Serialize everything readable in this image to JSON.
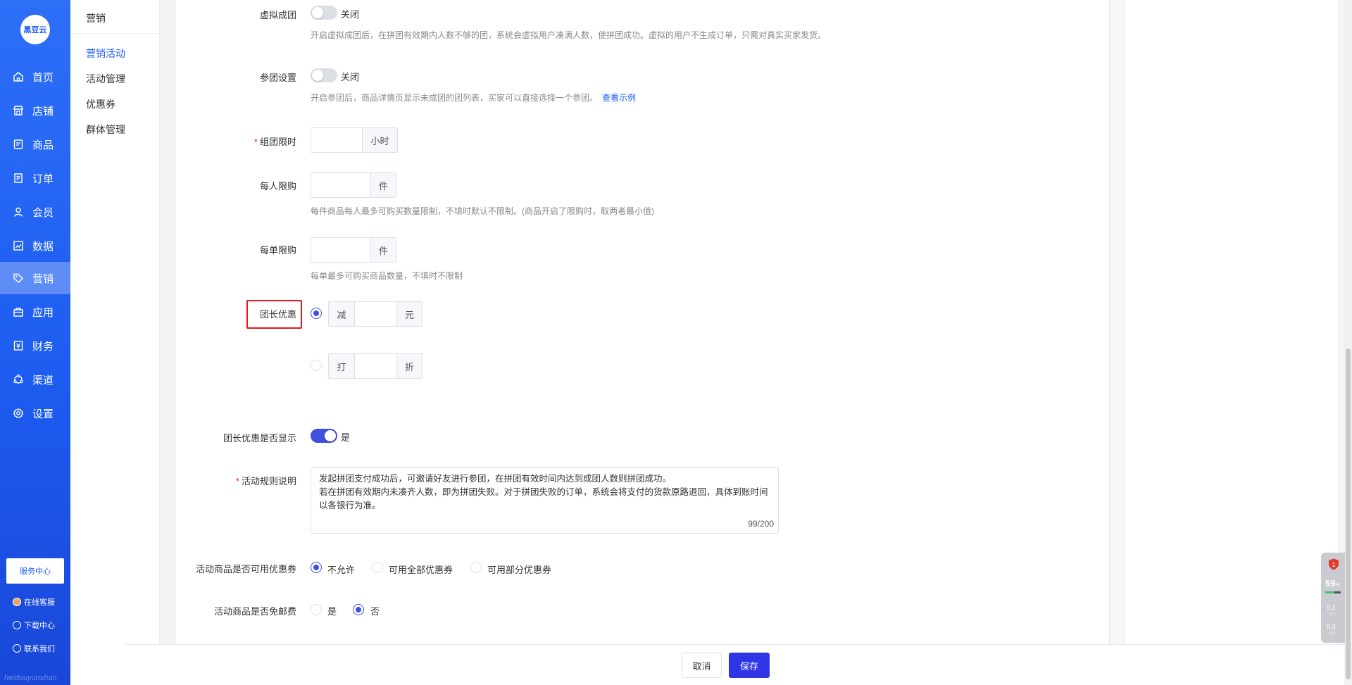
{
  "brand": {
    "logo_text": "黑豆云",
    "watermark": "heidouyunshan"
  },
  "nav": {
    "items": [
      {
        "label": "首页",
        "icon": "home-icon"
      },
      {
        "label": "店铺",
        "icon": "shop-icon"
      },
      {
        "label": "商品",
        "icon": "goods-icon"
      },
      {
        "label": "订单",
        "icon": "order-icon"
      },
      {
        "label": "会员",
        "icon": "member-icon"
      },
      {
        "label": "数据",
        "icon": "chart-icon"
      },
      {
        "label": "营销",
        "icon": "tag-icon"
      },
      {
        "label": "应用",
        "icon": "app-icon"
      },
      {
        "label": "财务",
        "icon": "finance-icon"
      },
      {
        "label": "渠道",
        "icon": "channel-icon"
      },
      {
        "label": "设置",
        "icon": "gear-icon"
      }
    ],
    "active": "营销",
    "service_center": "服务中心",
    "links": [
      {
        "label": "在线客服",
        "icon": "avatar-icon"
      },
      {
        "label": "下载中心",
        "icon": "download-icon"
      },
      {
        "label": "联系我们",
        "icon": "contact-icon"
      }
    ]
  },
  "subnav": {
    "title": "营销",
    "items": [
      "营销活动",
      "活动管理",
      "优惠券",
      "群体管理"
    ],
    "active": "营销活动"
  },
  "form": {
    "virtual_group": {
      "label": "虚拟成团",
      "switch_text": "关闭",
      "on": false,
      "hint": "开启虚拟成团后，在拼团有效期内人数不够的团，系统会虚拟用户凑满人数，使拼团成功。虚拟的用户不生成订单，只需对真实买家发货。"
    },
    "join_group": {
      "label": "参团设置",
      "switch_text": "关闭",
      "on": false,
      "hint": "开启参团后，商品详情页显示未成团的团列表，买家可以直接选择一个参团。",
      "link": "查看示例"
    },
    "group_time_limit": {
      "label": "组团限时",
      "required_mark": "*",
      "value": "",
      "unit": "小时"
    },
    "per_person_limit": {
      "label": "每人限购",
      "value": "",
      "unit": "件",
      "hint": "每件商品每人最多可购买数量限制，不填时默认不限制。(商品开启了限购时，取两者最小值)"
    },
    "per_order_limit": {
      "label": "每单限购",
      "value": "",
      "unit": "件",
      "hint": "每单最多可购买商品数量，不填时不限制"
    },
    "leader_discount": {
      "label": "团长优惠",
      "options": [
        {
          "prefix": "减",
          "value": "",
          "suffix": "元",
          "checked": true
        },
        {
          "prefix": "打",
          "value": "",
          "suffix": "折",
          "checked": false
        }
      ]
    },
    "leader_discount_display": {
      "label": "团长优惠是否显示",
      "switch_text": "是",
      "on": true
    },
    "rules": {
      "label": "活动规则说明",
      "required_mark": "*",
      "text": "发起拼团支付成功后，可邀请好友进行参团，在拼团有效时间内达到成团人数则拼团成功。\n若在拼团有效期内未凑齐人数，即为拼团失败。对于拼团失败的订单，系统会将支付的货款原路退回，具体到账时间以各银行为准。",
      "counter": "99/200"
    },
    "coupon_usage": {
      "label": "活动商品是否可用优惠券",
      "options": [
        {
          "label": "不允许",
          "checked": true
        },
        {
          "label": "可用全部优惠券",
          "checked": false
        },
        {
          "label": "可用部分优惠券",
          "checked": false
        }
      ]
    },
    "free_shipping": {
      "label": "活动商品是否免邮费",
      "options": [
        {
          "label": "是",
          "checked": false
        },
        {
          "label": "否",
          "checked": true
        }
      ]
    }
  },
  "footer": {
    "cancel": "取消",
    "save": "保存"
  },
  "monitor": {
    "badge": "1",
    "cpu_percent": "59",
    "cpu_unit": "%",
    "cpu_fraction": 0.59,
    "up_speed": "0.3",
    "down_speed": "0.3",
    "speed_unit": "K/s"
  },
  "colors": {
    "nav_blue": "#1d5cf0",
    "primary": "#3f4fe0",
    "save_button": "#3035e6",
    "required": "#f5222d",
    "highlight_box": "#e8161c"
  }
}
